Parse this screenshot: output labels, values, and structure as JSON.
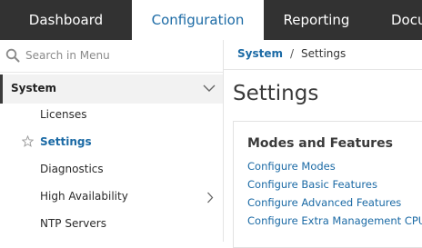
{
  "topnav": {
    "tabs": [
      {
        "label": "Dashboard"
      },
      {
        "label": "Configuration"
      },
      {
        "label": "Reporting"
      },
      {
        "label": "Docu"
      }
    ],
    "active_tab": "Configuration"
  },
  "sidebar": {
    "search": {
      "placeholder": "Search in Menu",
      "icon": "search-icon"
    },
    "section": {
      "label": "System",
      "expanded": true
    },
    "items": [
      {
        "label": "Licenses"
      },
      {
        "label": "Settings",
        "selected": true,
        "icon": "star-outline-icon"
      },
      {
        "label": "Diagnostics"
      },
      {
        "label": "High Availability",
        "has_submenu": true
      },
      {
        "label": "NTP Servers"
      }
    ]
  },
  "main": {
    "breadcrumb": {
      "parent": "System",
      "separator": "/",
      "current": "Settings"
    },
    "title": "Settings",
    "panel": {
      "title": "Modes and Features",
      "links": [
        {
          "label": "Configure Modes"
        },
        {
          "label": "Configure Basic Features"
        },
        {
          "label": "Configure Advanced Features"
        },
        {
          "label": "Configure Extra Management CPU"
        }
      ]
    }
  },
  "colors": {
    "nav_bg": "#323232",
    "accent": "#1b6aa5",
    "selected_row_bg": "#f2f2f2"
  }
}
